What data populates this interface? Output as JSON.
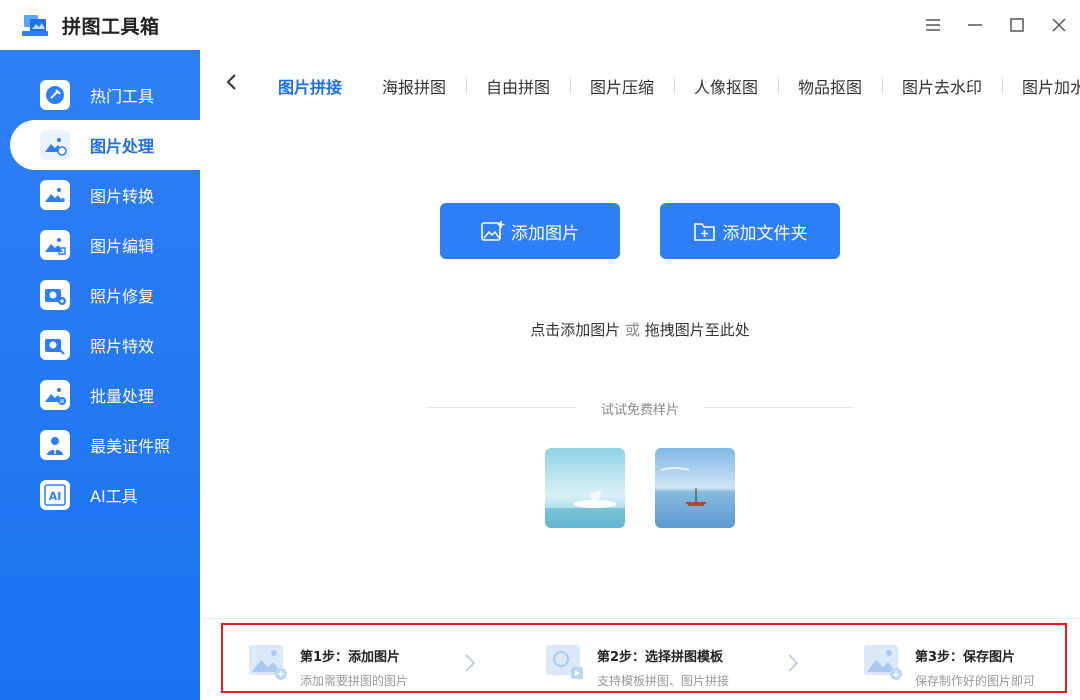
{
  "app": {
    "title": "拼图工具箱"
  },
  "window_controls": [
    "menu-icon",
    "minimize-icon",
    "maximize-icon",
    "close-icon"
  ],
  "sidebar": {
    "items": [
      {
        "label": "热门工具",
        "icon": "tools-icon"
      },
      {
        "label": "图片处理",
        "icon": "image-process-icon",
        "active": true
      },
      {
        "label": "图片转换",
        "icon": "image-convert-icon"
      },
      {
        "label": "图片编辑",
        "icon": "image-edit-icon"
      },
      {
        "label": "照片修复",
        "icon": "photo-repair-icon"
      },
      {
        "label": "照片特效",
        "icon": "photo-effect-icon"
      },
      {
        "label": "批量处理",
        "icon": "batch-icon"
      },
      {
        "label": "最美证件照",
        "icon": "id-photo-icon"
      },
      {
        "label": "AI工具",
        "icon": "ai-icon"
      }
    ]
  },
  "tabs": [
    {
      "label": "图片拼接",
      "active": true
    },
    {
      "label": "海报拼图"
    },
    {
      "label": "自由拼图"
    },
    {
      "label": "图片压缩"
    },
    {
      "label": "人像抠图"
    },
    {
      "label": "物品抠图"
    },
    {
      "label": "图片去水印"
    },
    {
      "label": "图片加水"
    }
  ],
  "main": {
    "add_image_label": "添加图片",
    "add_folder_label": "添加文件夹",
    "hint_prefix": "点击添加图片",
    "hint_or": "或",
    "hint_suffix": "拖拽图片至此处",
    "sample_title": "试试免费样片"
  },
  "steps": [
    {
      "title": "第1步：添加图片",
      "sub": "添加需要拼图的图片"
    },
    {
      "title": "第2步：选择拼图模板",
      "sub": "支持模板拼图、图片拼接"
    },
    {
      "title": "第3步：保存图片",
      "sub": "保存制作好的图片即可"
    }
  ],
  "colors": {
    "accent": "#2d7ef7",
    "sidebar": "#1a73f0",
    "highlight_border": "#e02020"
  }
}
